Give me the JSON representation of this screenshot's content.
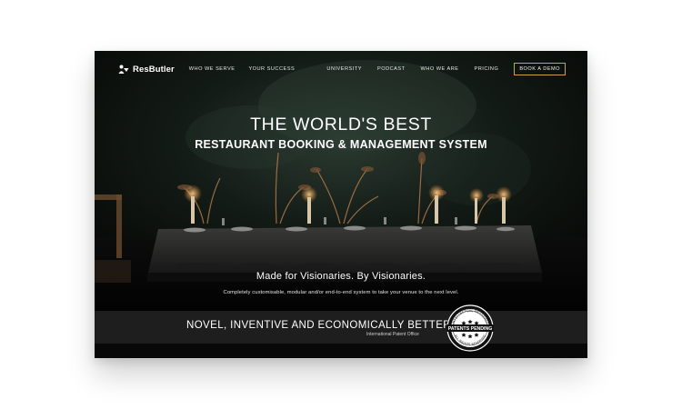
{
  "brand": {
    "name": "ResButler"
  },
  "nav": {
    "left_links": [
      "WHO WE SERVE",
      "YOUR SUCCESS"
    ],
    "right_links": [
      "UNIVERSITY",
      "PODCAST",
      "WHO WE ARE",
      "PRICING"
    ],
    "cta": "BOOK A DEMO"
  },
  "hero": {
    "title": "THE WORLD'S BEST",
    "subtitle": "RESTAURANT BOOKING & MANAGEMENT SYSTEM",
    "tagline": "Made for Visionaries. By Visionaries.",
    "description": "Completely customisable, modular and/or end-to-end system to take your venue to the next level."
  },
  "band": {
    "title": "NOVEL, INVENTIVE AND ECONOMICALLY BETTER",
    "subtitle": "International Patent Office"
  },
  "seal": {
    "center_text": "PATENTS PENDING",
    "ring_top": "INTELLECTUAL PROPERTY",
    "ring_bottom": "ALL RIGHTS RESERVED"
  },
  "colors": {
    "background": "#070807",
    "band": "#1e1e1e",
    "accent_gold": "#c8a24a",
    "candle": "#ffb45a"
  }
}
